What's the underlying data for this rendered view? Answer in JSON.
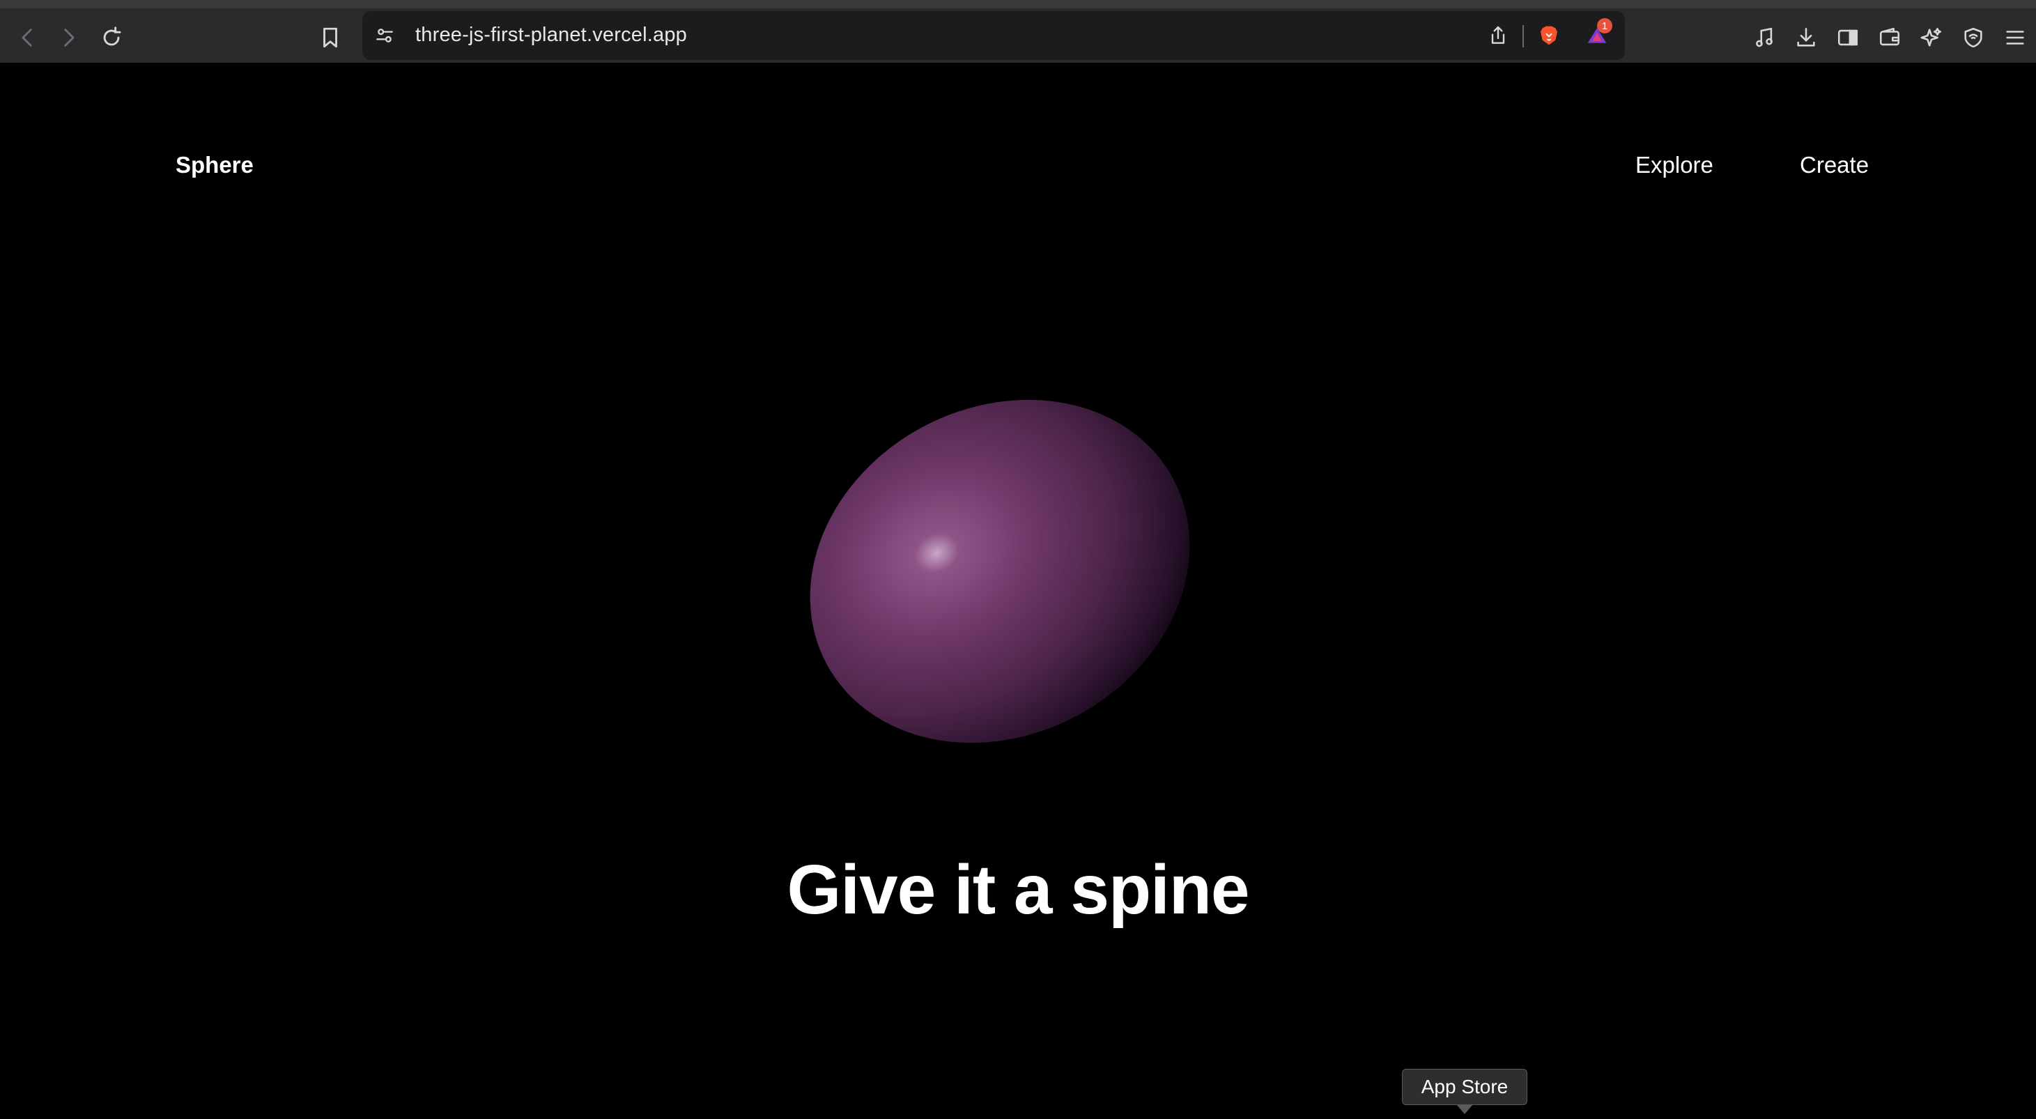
{
  "browser": {
    "url": "three-js-first-planet.vercel.app",
    "notification_count": "1",
    "icons": {
      "back": "back-arrow-icon",
      "forward": "forward-arrow-icon",
      "reload": "reload-icon",
      "bookmark": "bookmark-icon",
      "site_settings": "site-settings-icon",
      "share": "share-icon",
      "brave_shields": "brave-lion-icon",
      "rewards": "brave-rewards-icon",
      "media": "music-note-icon",
      "downloads": "download-icon",
      "sidebar": "sidebar-icon",
      "wallet": "wallet-icon",
      "leo": "leo-ai-icon",
      "vpn": "vpn-shield-icon",
      "menu": "hamburger-menu-icon"
    }
  },
  "site": {
    "brand": "Sphere",
    "nav": [
      {
        "label": "Explore"
      },
      {
        "label": "Create"
      }
    ],
    "headline": "Give it a spine",
    "sphere_color": "#7a3d74"
  },
  "tooltip": {
    "text": "App Store"
  },
  "colors": {
    "background": "#000000",
    "toolbar": "#2b2b2d",
    "urlbar": "#1c1c1e",
    "accent_brave": "#fb542b",
    "sphere_highlight": "#c9a7c6"
  }
}
